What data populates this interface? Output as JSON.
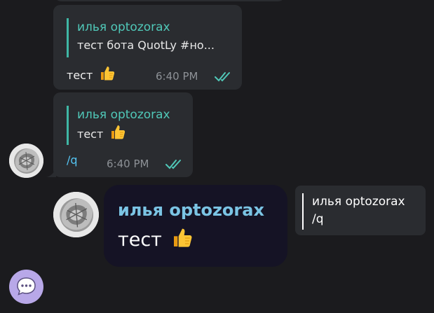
{
  "messages": [
    {
      "reply_author": "илья optozorax",
      "reply_text": "тест бота QuotLy  #но...",
      "text": "тест",
      "time": "6:40 PM"
    },
    {
      "reply_author": "илья optozorax",
      "reply_text": "тест",
      "text": "/q",
      "time": "6:40 PM"
    }
  ],
  "quote_sticker": {
    "author": "илья optozorax",
    "text": "тест"
  },
  "reply_preview": {
    "author": "илья optozorax",
    "text": "/q"
  },
  "colors": {
    "background": "#1b1b1e",
    "bubble": "#2a2c30",
    "reply_accent": "#3fb7a5",
    "quote_bg": "#151325",
    "quote_author": "#7bc4e4",
    "fab": "#b8a8e8"
  },
  "icons": [
    "thumbs-up-emoji",
    "double-check-icon",
    "cabbage-avatar",
    "chat-bubble-icon"
  ]
}
